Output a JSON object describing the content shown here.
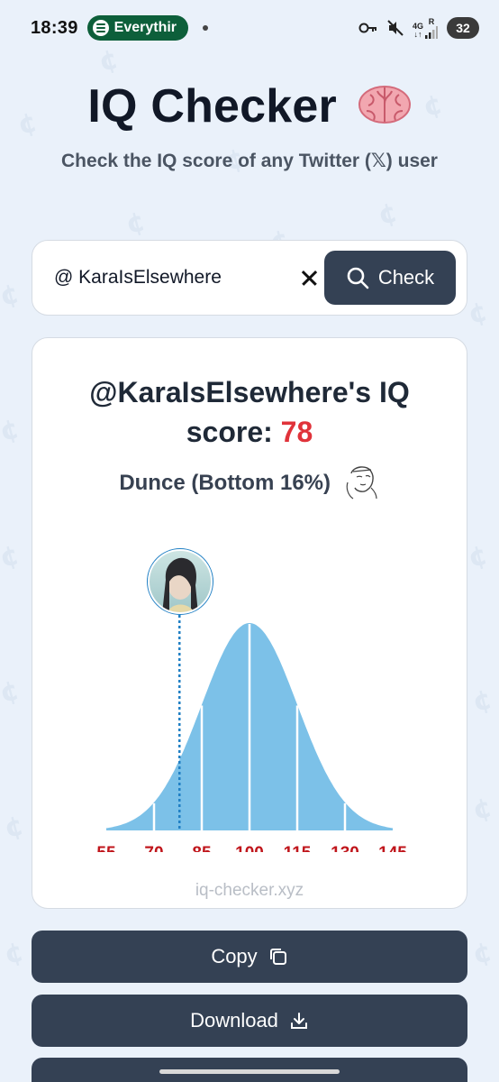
{
  "status_bar": {
    "time": "18:39",
    "media_app": "Everythir",
    "network": "4G",
    "roaming": "R",
    "battery": "32"
  },
  "header": {
    "title": "IQ Checker",
    "title_emoji": "brain-icon",
    "subtitle": "Check the IQ score of any Twitter (𝕏) user"
  },
  "search": {
    "value": "@ KaraIsElsewhere",
    "placeholder": "",
    "check_label": "Check"
  },
  "result": {
    "title_prefix": "@KaraIsElsewhere's IQ",
    "score_label": "score: ",
    "score": "78",
    "category": "Dunce (Bottom 16%)",
    "watermark": "iq-checker.xyz"
  },
  "chart_data": {
    "type": "area",
    "title": "",
    "xlabel": "",
    "ylabel": "",
    "x_ticks": [
      "55",
      "70",
      "85",
      "100",
      "115",
      "130",
      "145"
    ],
    "x": [
      55,
      70,
      85,
      100,
      115,
      130,
      145
    ],
    "distribution": {
      "mean": 100,
      "sd": 15
    },
    "marker": {
      "x": 78,
      "label": "avatar"
    },
    "xlim": [
      55,
      145
    ],
    "colors": {
      "fill": "#7cc1e8",
      "tick_labels": "#c0161c",
      "marker": "#1f7fc4"
    }
  },
  "actions": {
    "copy_label": "Copy",
    "download_label": "Download"
  },
  "colors": {
    "accent_button": "#344154",
    "score_red": "#e0333a",
    "background": "#eaf1fa"
  }
}
